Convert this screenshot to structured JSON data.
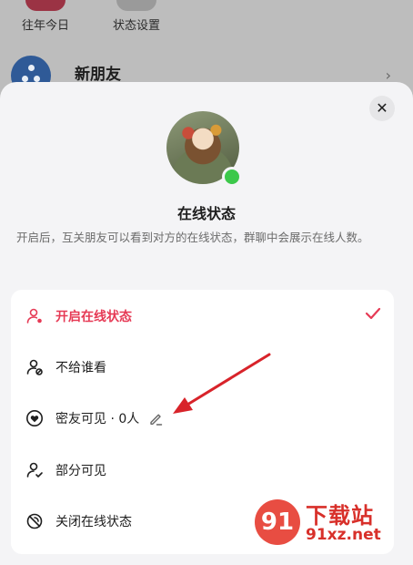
{
  "background": {
    "shortcuts": [
      {
        "label": "往年今日"
      },
      {
        "label": "状态设置"
      }
    ],
    "new_friend": {
      "label": "新朋友"
    }
  },
  "sheet": {
    "title": "在线状态",
    "description": "开启后，互关朋友可以看到对方的在线状态，群聊中会展示在线人数。",
    "close_icon": "close-icon",
    "online_indicator_color": "#3cc84a",
    "options": [
      {
        "label": "开启在线状态",
        "icon": "user-online-icon",
        "selected": true
      },
      {
        "label": "不给谁看",
        "icon": "user-block-icon",
        "selected": false
      },
      {
        "label": "密友可见 · 0人",
        "icon": "heart-circle-icon",
        "selected": false
      },
      {
        "label": "部分可见",
        "icon": "user-check-icon",
        "selected": false
      },
      {
        "label": "关闭在线状态",
        "icon": "offline-icon",
        "selected": false
      }
    ]
  },
  "colors": {
    "accent": "#e63a55",
    "annotation_arrow": "#d8232a"
  },
  "watermark": {
    "brand": "下载站",
    "domain": "91xz.net",
    "logo_text": "91"
  }
}
